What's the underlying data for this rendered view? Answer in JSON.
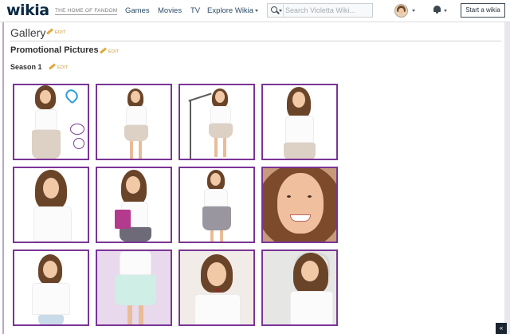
{
  "header": {
    "logo_text": "wikia",
    "tagline": "THE HOME OF FANDOM",
    "nav": [
      "Games",
      "Movies",
      "TV",
      "Explore Wikia"
    ],
    "search_placeholder": "Search Violetta Wiki...",
    "start_wiki_label": "Start a wikia"
  },
  "page": {
    "gallery_heading": "Gallery",
    "promo_heading": "Promotional Pictures",
    "season_heading": "Season 1",
    "edit_label": "EDIT"
  },
  "icons": {
    "search": "search-icon",
    "notifications": "bell-icon",
    "edit": "pencil-icon",
    "avatar": "user-avatar"
  },
  "colors": {
    "thumb_border": "#7a3595",
    "edit_link": "#c7952a",
    "brand": "#0a2a43"
  },
  "gallery": {
    "thumbnails": [
      {
        "label": "violetta-doodle-heart"
      },
      {
        "label": "violetta-white-top-standing"
      },
      {
        "label": "violetta-microphone-stand"
      },
      {
        "label": "violetta-white-top-close"
      },
      {
        "label": "violetta-headphones"
      },
      {
        "label": "violetta-holding-book"
      },
      {
        "label": "violetta-patterned-skirt"
      },
      {
        "label": "violetta-smiling-closeup"
      },
      {
        "label": "violetta-hands-on-hips"
      },
      {
        "label": "violetta-lilac-background"
      },
      {
        "label": "violetta-surprised"
      },
      {
        "label": "violetta-headphones-grey"
      }
    ]
  }
}
